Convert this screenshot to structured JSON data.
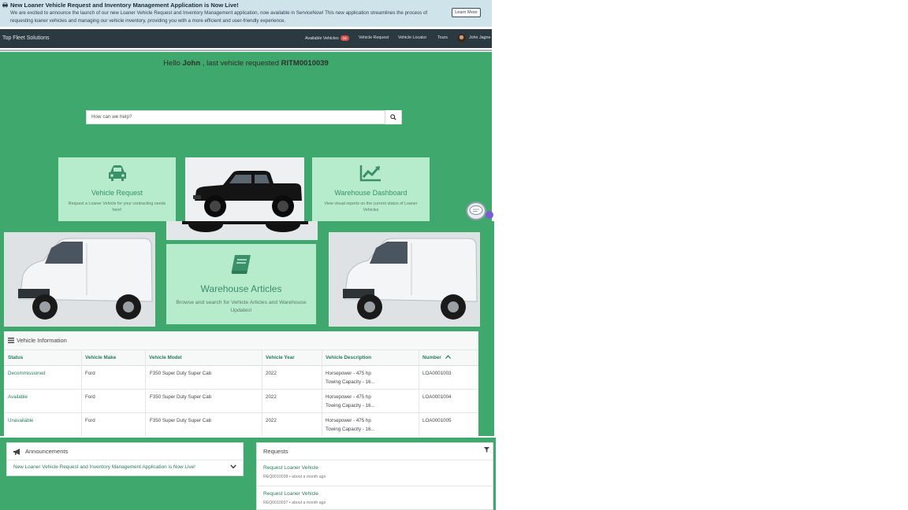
{
  "banner": {
    "title": "New Loaner Vehicle Request and Inventory Management Application is Now Live!",
    "text": "We are excited to announce the launch of our new Loaner Vehicle Request and Inventory Management application, now available in ServiceNow! This new application streamlines the process of requesting loaner vehicles and managing our vehicle inventory, providing you with a more efficient and user-friendly experience.",
    "button": "Learn More",
    "icon": "car-icon"
  },
  "navbar": {
    "brand": "Top Fleet Solutions",
    "items": [
      {
        "label": "Available Vehicles",
        "badge": "16"
      },
      {
        "label": "Vehicle Request"
      },
      {
        "label": "Vehicle Locator"
      },
      {
        "label": "Tours"
      }
    ],
    "user": "John Jagne"
  },
  "hero": {
    "hello_prefix": "Hello",
    "user_name": "John",
    "hello_middle": ", last vehicle requested",
    "last_request": "RITM0010039"
  },
  "search": {
    "placeholder": "How can we help?",
    "icon": "search-icon"
  },
  "tiles": [
    {
      "title": "Vehicle Request",
      "desc": "Request a Loaner Vehicle for your contracting needs here!",
      "icon": "car-icon"
    },
    {
      "title": "Warehouse Dashboard",
      "desc": "View visual reports on the current status of Loaner Vehicles",
      "icon": "chart-line-icon"
    },
    {
      "title": "Warehouse Articles",
      "desc": "Browse and search for Vehicle Articles and Warehouse Updates!",
      "icon": "book-icon"
    }
  ],
  "vehicle_info": {
    "title": "Vehicle Information",
    "columns": [
      "Status",
      "Vehicle Make",
      "Vehicle Model",
      "Vehicle Year",
      "Vehicle Description",
      "Number"
    ],
    "rows": [
      {
        "status": "Decommissioned",
        "make": "Ford",
        "model": "F350 Super Duty Super Cab",
        "year": "2022",
        "desc1": "Horsepower - 475 hp",
        "desc2": "Towing Capacity - 16...",
        "number": "LOA0001003"
      },
      {
        "status": "Available",
        "make": "Ford",
        "model": "F350 Super Duty Super Cab",
        "year": "2022",
        "desc1": "Horsepower - 475 hp",
        "desc2": "Towing Capacity - 16...",
        "number": "LOA0001004"
      },
      {
        "status": "Unavailable",
        "make": "Ford",
        "model": "F350 Super Duty Super Cab",
        "year": "2022",
        "desc1": "Horsepower - 475 hp",
        "desc2": "Towing Capacity - 16...",
        "number": "LOA0001005"
      }
    ]
  },
  "announcements": {
    "title": "Announcements",
    "item": "New Loaner Vehicle Request and Inventory Management Application is Now Live!",
    "icon": "megaphone-icon"
  },
  "requests": {
    "title": "Requests",
    "items": [
      {
        "title": "Request Loaner Vehicle",
        "meta": "REQ0010038 • about a month ago"
      },
      {
        "title": "Request Loaner Vehicle",
        "meta": "REQ0010037 • about a month ago"
      }
    ]
  },
  "colors": {
    "accent": "#3fa86c",
    "tile": "#b6ebcc",
    "navbar": "#2b3a40",
    "banner": "#cfe3ea",
    "link": "#2a7a5e"
  }
}
